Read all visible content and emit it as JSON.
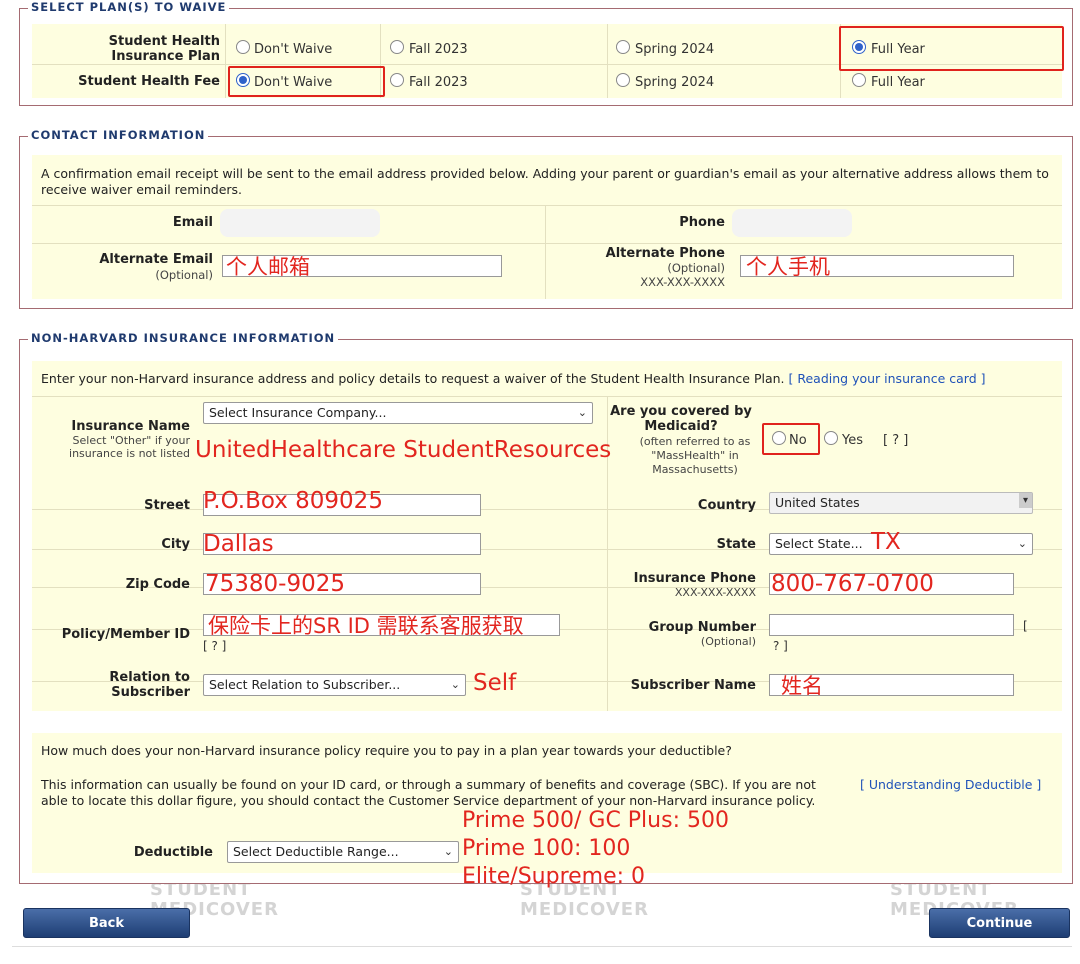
{
  "plan": {
    "legend": "SELECT PLAN(S) TO WAIVE",
    "rows": [
      {
        "label": "Student Health Insurance Plan",
        "options": [
          "Don't Waive",
          "Fall 2023",
          "Spring 2024",
          "Full Year"
        ],
        "selected": "Full Year"
      },
      {
        "label": "Student Health Fee",
        "options": [
          "Don't Waive",
          "Fall 2023",
          "Spring 2024",
          "Full Year"
        ],
        "selected": "Don't Waive"
      }
    ]
  },
  "contact": {
    "legend": "CONTACT INFORMATION",
    "intro": "A confirmation email receipt will be sent to the email address provided below. Adding your parent or guardian's email as your alternative address allows them to receive waiver email reminders.",
    "email_label": "Email",
    "phone_label": "Phone",
    "alt_email_label": "Alternate Email",
    "alt_email_hint": "(Optional)",
    "alt_email_value": "个人邮箱",
    "alt_phone_label": "Alternate Phone",
    "alt_phone_hint": "(Optional)",
    "alt_phone_format": "XXX-XXX-XXXX",
    "alt_phone_value": "个人手机"
  },
  "insurance": {
    "legend": "NON-HARVARD INSURANCE INFORMATION",
    "intro": "Enter your non-Harvard insurance address and policy details to request a waiver of the Student Health Insurance Plan.",
    "intro_link": "[ Reading your insurance card ]",
    "name_label": "Insurance Name",
    "name_hint": "Select \"Other\" if your insurance is not listed",
    "name_select": "Select Insurance Company...",
    "name_value": "UnitedHealthcare StudentResources",
    "medicaid_label": "Are you covered by Medicaid?",
    "medicaid_hint": "(often referred to as \"MassHealth\" in Massachusetts)",
    "medicaid_no": "No",
    "medicaid_yes": "Yes",
    "help": "[ ? ]",
    "street_label": "Street",
    "street_value": "P.O.Box 809025",
    "country_label": "Country",
    "country_value": "United States",
    "city_label": "City",
    "city_value": "Dallas",
    "state_label": "State",
    "state_select": "Select State...",
    "state_value": "TX",
    "zip_label": "Zip Code",
    "zip_value": "75380-9025",
    "ins_phone_label": "Insurance Phone",
    "ins_phone_format": "XXX-XXX-XXXX",
    "ins_phone_value": "800-767-0700",
    "policy_label": "Policy/Member ID",
    "policy_value": "保险卡上的SR ID 需联系客服获取",
    "policy_help": "[ ? ]",
    "group_label": "Group Number",
    "group_hint": "(Optional)",
    "group_help_a": "[",
    "group_help_b": "? ]",
    "relation_label": "Relation to Subscriber",
    "relation_select": "Select Relation to Subscriber...",
    "relation_value": "Self",
    "subscriber_label": "Subscriber Name",
    "subscriber_value": "姓名",
    "deduct_question": "How much does your non-Harvard insurance policy require you to pay in a plan year towards your deductible?",
    "deduct_info": "This information can usually be found on your ID card, or through a summary of benefits and coverage (SBC). If you are not able to locate this dollar figure, you should contact the Customer Service department of your non-Harvard insurance policy.",
    "deduct_link": "[ Understanding Deductible ]",
    "deduct_label": "Deductible",
    "deduct_select": "Select Deductible Range...",
    "deduct_notes": [
      "Prime 500/ GC Plus: 500",
      "Prime 100: 100",
      "Elite/Supreme: 0"
    ]
  },
  "buttons": {
    "back": "Back",
    "continue": "Continue"
  },
  "watermark": {
    "line1": "STUDENT",
    "line2": "MEDICOVER"
  },
  "colors": {
    "annotation": "#e2261f",
    "accent": "#2f62c9",
    "panel": "#fefee0",
    "button": "#1e3e74"
  }
}
